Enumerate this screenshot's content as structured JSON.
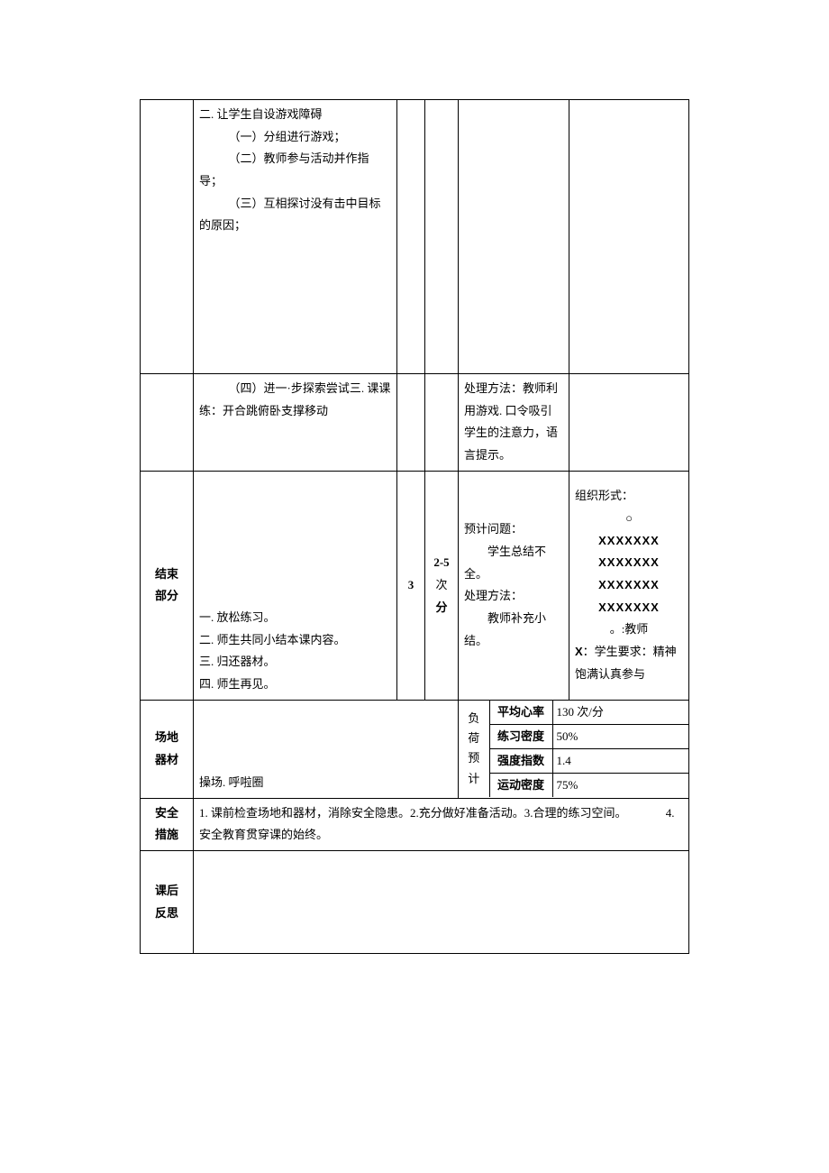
{
  "row1": {
    "content": {
      "l1": "二. 让学生自设游戏障碍",
      "l2": "（一）分组进行游戏；",
      "l3": "（二）教师参与活动并作指导；",
      "l4": "（三）互相探讨没有击中目标的原因；"
    }
  },
  "row2": {
    "content": "（四）进一·步探索尝试三. 课课练：开合跳俯卧支撑移动",
    "problem": "处理方法：教师利用游戏. 口令吸引学生的注意力，语言提示。"
  },
  "end": {
    "label_a": "结束",
    "label_b": "部分",
    "content": {
      "l1": "一. 放松练习。",
      "l2": "二. 师生共同小结本课内容。",
      "l3": "三. 归还器材。",
      "l4": "四. 师生再见。"
    },
    "col_a": "3",
    "col_b_main": "2-5",
    "col_b_sub": "次",
    "col_b_unit": "分",
    "problem": {
      "p1": "预计问题：",
      "p2": "学生总结不全。",
      "p3": "处理方法：",
      "p4": "教师补充小结。"
    },
    "org": {
      "title": "组织形式：",
      "circle": "○",
      "x": "XXXXXXX",
      "legend1": "。:教师",
      "legend2_prefix": "X",
      "legend2_rest": "：学生要求：精神饱满认真参与"
    }
  },
  "venue": {
    "label_a": "场地",
    "label_b": "器材",
    "value": "操场. 呼啦圈"
  },
  "load": {
    "label_a": "负荷",
    "label_b": "预计",
    "rows": [
      {
        "k": "平均心率",
        "v": "130 次/分"
      },
      {
        "k": "练习密度",
        "v": "50%"
      },
      {
        "k": "强度指数",
        "v": "1.4"
      },
      {
        "k": "运动密度",
        "v": "75%"
      }
    ]
  },
  "safety": {
    "label_a": "安全",
    "label_b": "措施",
    "value_a": "1. 课前检查场地和器材，消除安全隐患。2.充分做好准备活动。3.合理的练习空间。",
    "value_b": "4. 安全教育贯穿课的始终。"
  },
  "reflect": {
    "label_a": "课后",
    "label_b": "反思"
  }
}
